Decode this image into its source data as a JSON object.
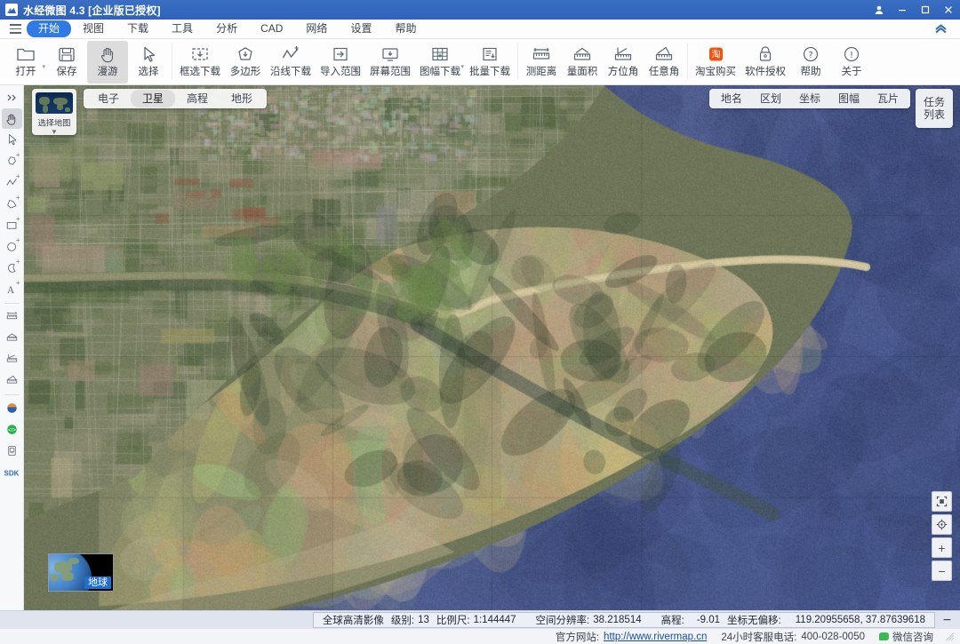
{
  "window": {
    "title": "水经微图 4.3 [企业版已授权]",
    "logo_icon": "mountain-logo-icon",
    "controls": [
      {
        "name": "user-account",
        "icon": "user-icon",
        "label": "\u0000"
      },
      {
        "name": "minimize",
        "icon": "minimize-icon",
        "label": ""
      },
      {
        "name": "maximize",
        "icon": "maximize-icon",
        "label": ""
      },
      {
        "name": "close",
        "icon": "close-icon",
        "label": ""
      }
    ]
  },
  "menubar": {
    "hamburger_icon": "hamburger-icon",
    "collapse_icon": "chevron-up-icon",
    "items": [
      {
        "label": "开始",
        "active": true
      },
      {
        "label": "视图",
        "active": false
      },
      {
        "label": "下载",
        "active": false
      },
      {
        "label": "工具",
        "active": false
      },
      {
        "label": "分析",
        "active": false
      },
      {
        "label": "CAD",
        "active": false
      },
      {
        "label": "网络",
        "active": false
      },
      {
        "label": "设置",
        "active": false
      },
      {
        "label": "帮助",
        "active": false
      }
    ]
  },
  "ribbon": {
    "items": [
      {
        "label": "打开",
        "icon": "folder-open-icon",
        "dropdown": true,
        "selected": false
      },
      {
        "label": "保存",
        "icon": "save-disk-icon",
        "dropdown": false,
        "selected": false
      },
      {
        "label": "漫游",
        "icon": "hand-pan-icon",
        "dropdown": false,
        "selected": true
      },
      {
        "label": "选择",
        "icon": "cursor-arrow-icon",
        "dropdown": false,
        "selected": false
      },
      {
        "sep": true
      },
      {
        "label": "框选下载",
        "icon": "box-select-download-icon",
        "dropdown": false,
        "selected": false
      },
      {
        "label": "多边形",
        "icon": "polygon-download-icon",
        "dropdown": false,
        "selected": false
      },
      {
        "label": "沿线下载",
        "icon": "polyline-download-icon",
        "dropdown": false,
        "selected": false
      },
      {
        "label": "导入范围",
        "icon": "import-range-icon",
        "dropdown": false,
        "selected": false
      },
      {
        "label": "屏幕范围",
        "icon": "screen-range-icon",
        "dropdown": false,
        "selected": false
      },
      {
        "label": "图幅下载",
        "icon": "sheet-download-icon",
        "dropdown": true,
        "selected": false
      },
      {
        "label": "批量下载",
        "icon": "batch-download-icon",
        "dropdown": false,
        "selected": false
      },
      {
        "sep": true
      },
      {
        "label": "测距离",
        "icon": "measure-distance-icon",
        "dropdown": false,
        "selected": false
      },
      {
        "label": "量面积",
        "icon": "measure-area-icon",
        "dropdown": false,
        "selected": false
      },
      {
        "label": "方位角",
        "icon": "azimuth-icon",
        "dropdown": false,
        "selected": false
      },
      {
        "label": "任意角",
        "icon": "any-angle-icon",
        "dropdown": false,
        "selected": false
      },
      {
        "sep": true
      },
      {
        "label": "淘宝购买",
        "icon": "taobao-icon",
        "dropdown": false,
        "selected": false
      },
      {
        "label": "软件授权",
        "icon": "lock-license-icon",
        "dropdown": false,
        "selected": false
      },
      {
        "label": "帮助",
        "icon": "question-circle-icon",
        "dropdown": false,
        "selected": false
      },
      {
        "label": "关于",
        "icon": "info-circle-icon",
        "dropdown": false,
        "selected": false
      }
    ]
  },
  "left_toolbar": {
    "items": [
      {
        "name": "expand-panel",
        "icon": "chevrons-right-icon",
        "selected": false
      },
      {
        "name": "pan-tool",
        "icon": "hand-pan-icon",
        "selected": true
      },
      {
        "name": "select-tool",
        "icon": "cursor-arrow-icon",
        "selected": false
      },
      {
        "name": "add-marker-shape",
        "icon": "blob-plus-icon",
        "selected": false
      },
      {
        "name": "add-polyline",
        "icon": "polyline-plus-icon",
        "selected": false
      },
      {
        "name": "add-polygon",
        "icon": "polygon-plus-icon",
        "selected": false
      },
      {
        "name": "add-rectangle",
        "icon": "rectangle-plus-icon",
        "selected": false
      },
      {
        "name": "add-circle",
        "icon": "circle-plus-icon",
        "selected": false
      },
      {
        "name": "add-arc",
        "icon": "crescent-plus-icon",
        "selected": false
      },
      {
        "name": "add-text",
        "icon": "text-plus-icon",
        "selected": false
      },
      {
        "sep": true
      },
      {
        "name": "measure-distance",
        "icon": "measure-distance-icon",
        "selected": false
      },
      {
        "name": "measure-area",
        "icon": "measure-area-icon",
        "selected": false
      },
      {
        "name": "measure-azimuth",
        "icon": "azimuth-icon",
        "selected": false
      },
      {
        "name": "measure-angle",
        "icon": "any-angle-icon",
        "selected": false
      },
      {
        "sep": true
      },
      {
        "name": "earth-globe-app",
        "icon": "globe-color-icon",
        "selected": false
      },
      {
        "name": "script-plugin",
        "icon": "code-green-icon",
        "selected": false
      },
      {
        "name": "device-module",
        "icon": "device-icon",
        "selected": false
      },
      {
        "name": "sdk-module",
        "icon": "sdk-text-icon",
        "selected": false
      }
    ],
    "sdk_label": "SDK"
  },
  "map_overlay": {
    "thumb_label": "选择地图",
    "thumb_caret_icon": "chevron-down-icon",
    "map_types": [
      {
        "label": "电子",
        "active": false
      },
      {
        "label": "卫星",
        "active": true
      },
      {
        "label": "高程",
        "active": false
      },
      {
        "label": "地形",
        "active": false
      }
    ],
    "top_right_tabs": [
      {
        "label": "地名"
      },
      {
        "label": "区划"
      },
      {
        "label": "坐标"
      },
      {
        "label": "图幅"
      },
      {
        "label": "瓦片"
      }
    ],
    "task_list_label": "任务列表",
    "controls": [
      {
        "name": "fit-extent-button",
        "icon": "fit-extent-icon",
        "label": ""
      },
      {
        "name": "locate-button",
        "icon": "crosshair-icon",
        "label": ""
      },
      {
        "name": "zoom-in-button",
        "icon": "plus-icon",
        "label": "+"
      },
      {
        "name": "zoom-out-button",
        "icon": "minus-icon",
        "label": "−"
      }
    ],
    "globe_label": "地球"
  },
  "status_bar": {
    "source": "全球高清影像",
    "level_key": "级别:",
    "level_value": "13",
    "scale_key": "比例尺:",
    "scale_value": "1:144447",
    "resolution_key": "空间分辨率:",
    "resolution_value": "38.218514",
    "elevation_key": "高程:",
    "elevation_value": "-9.01",
    "coord_key": "坐标无偏移:",
    "coord_value": "119.20955658, 37.87639618",
    "minimize_icon": "minus-icon"
  },
  "footer": {
    "site_label": "官方网站:",
    "site_url": "http://www.rivermap.cn",
    "phone_label": "24小时客服电话:",
    "phone_value": "400-028-0050",
    "wechat_icon": "wechat-icon",
    "wechat_label": "微信咨询",
    "grip_icon": "resize-grip-icon"
  },
  "colors": {
    "titlebar": "#2f62b8",
    "accent": "#2f7ae5",
    "sea": "#4d5d92",
    "taobao": "#f4520f",
    "ribbon_bg": "#fdfdfd"
  }
}
